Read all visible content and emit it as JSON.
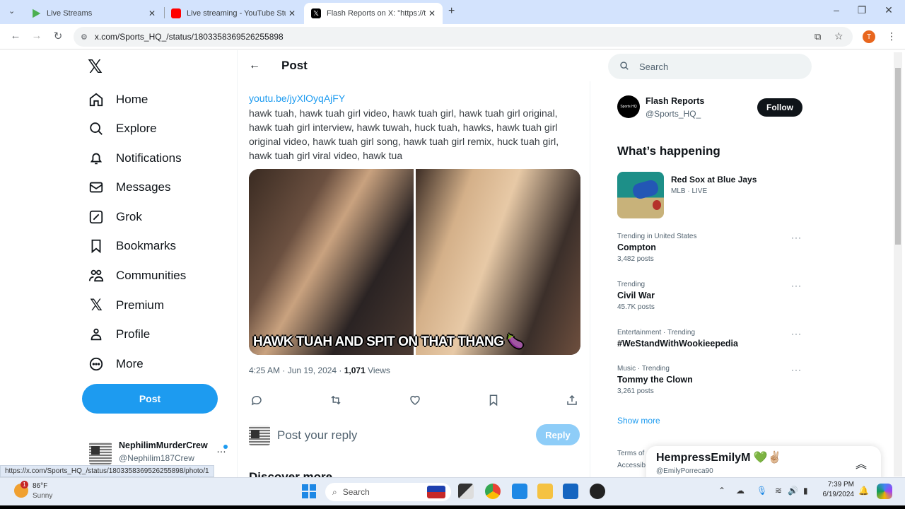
{
  "browser": {
    "tabs": [
      {
        "title": "Live Streams",
        "favicon": "rumble-icon",
        "color": "#4caf50"
      },
      {
        "title": "Live streaming - YouTube Studi",
        "favicon": "youtube-icon",
        "color": "#ff0000"
      },
      {
        "title": "Flash Reports on X: \"https://t.co",
        "favicon": "x-icon",
        "color": "#000000",
        "active": true
      }
    ],
    "url": "x.com/Sports_HQ_/status/1803358369526255898",
    "status_url": "https://x.com/Sports_HQ_/status/1803358369526255898/photo/1",
    "profile_initial": "T"
  },
  "sidebar": {
    "items": [
      {
        "label": "Home",
        "icon": "home-icon"
      },
      {
        "label": "Explore",
        "icon": "search-icon"
      },
      {
        "label": "Notifications",
        "icon": "bell-icon"
      },
      {
        "label": "Messages",
        "icon": "envelope-icon"
      },
      {
        "label": "Grok",
        "icon": "grok-icon"
      },
      {
        "label": "Bookmarks",
        "icon": "bookmark-icon"
      },
      {
        "label": "Communities",
        "icon": "communities-icon"
      },
      {
        "label": "Premium",
        "icon": "x-logo-icon"
      },
      {
        "label": "Profile",
        "icon": "person-icon"
      },
      {
        "label": "More",
        "icon": "more-circle-icon"
      }
    ],
    "post_label": "Post",
    "account": {
      "name": "NephilimMurderCrew",
      "handle": "@Nephilim187Crew"
    }
  },
  "post": {
    "header": "Post",
    "link": "youtu.be/jyXlOyqAjFY",
    "text": "hawk tuah, hawk tuah girl video, hawk tuah girl, hawk tuah girl original, hawk tuah girl interview, hawk tuwah, huck tuah, hawks, hawk tuah girl original video, hawk tuah girl song, hawk tuah girl remix, huck tuah girl, hawk tuah girl viral video, hawk tua",
    "media_caption": "HAWK TUAH AND SPIT ON THAT THANG 🍆",
    "time": "4:25 AM · Jun 19, 2024 · ",
    "views_count": "1,071",
    "views_label": " Views",
    "reply_placeholder": "Post your reply",
    "reply_label": "Reply",
    "discover": "Discover more"
  },
  "right": {
    "search_placeholder": "Search",
    "who": {
      "name": "Flash Reports",
      "handle": "@Sports_HQ_",
      "avatar_text": "Sports HQ",
      "follow_label": "Follow"
    },
    "whats_happening": "What’s happening",
    "live": {
      "title": "Red Sox at Blue Jays",
      "sub": "MLB · LIVE"
    },
    "trends": [
      {
        "context": "Trending in United States",
        "name": "Compton",
        "count": "3,482 posts"
      },
      {
        "context": "Trending",
        "name": "Civil War",
        "count": "45.7K posts"
      },
      {
        "context": "Entertainment · Trending",
        "name": "#WeStandWithWookieepedia",
        "count": ""
      },
      {
        "context": "Music · Trending",
        "name": "Tommy the Clown",
        "count": "3,261 posts"
      }
    ],
    "show_more": "Show more",
    "terms": [
      "Terms of",
      "Accessib"
    ],
    "dm": {
      "name": "HempressEmilyM 💚✌🏼",
      "handle": "@EmilyPorreca90"
    }
  },
  "taskbar": {
    "weather_temp": "86°F",
    "weather_desc": "Sunny",
    "weather_badge": "1",
    "search_label": "Search",
    "time": "7:39 PM",
    "date": "6/19/2024"
  }
}
